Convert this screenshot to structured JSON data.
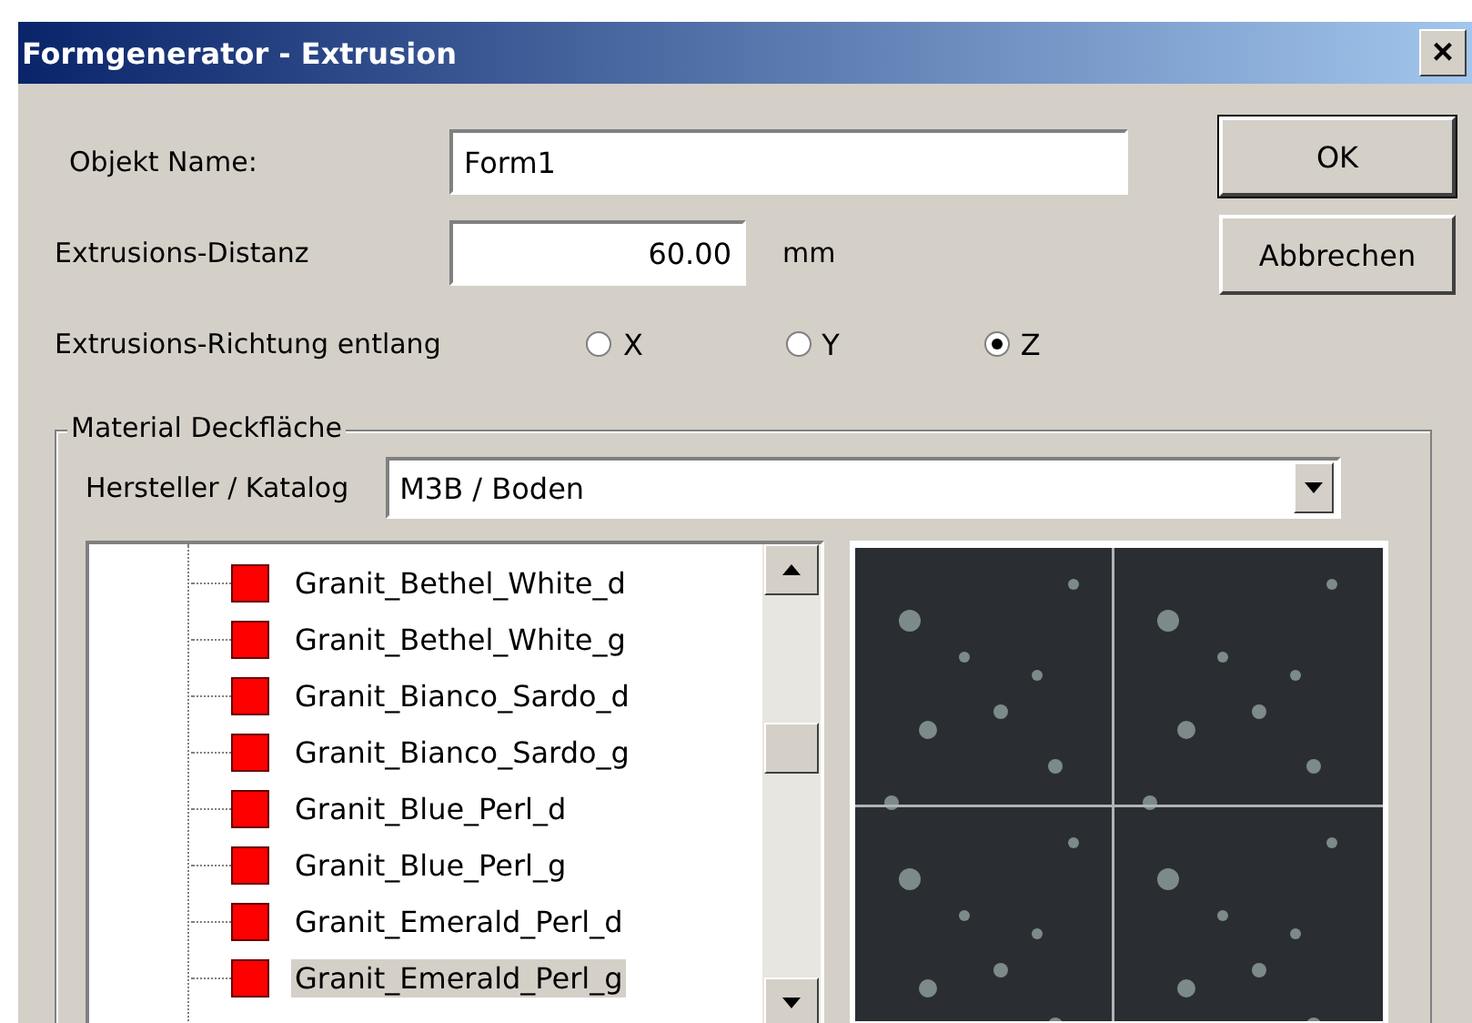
{
  "window": {
    "title": "Formgenerator - Extrusion",
    "close": "×"
  },
  "object_name": {
    "label": "Objekt Name:",
    "value": "Form1"
  },
  "distance": {
    "label": "Extrusions-Distanz",
    "value": "60.00",
    "unit": "mm"
  },
  "direction": {
    "label": "Extrusions-Richtung entlang",
    "options": [
      {
        "label": "X",
        "selected": false
      },
      {
        "label": "Y",
        "selected": false
      },
      {
        "label": "Z",
        "selected": true
      }
    ]
  },
  "buttons": [
    "OK",
    "Abbrechen"
  ],
  "material": {
    "title": "Material Deckfläche",
    "catalog_label": "Hersteller / Katalog",
    "catalog_value": "M3B / Boden",
    "items": [
      {
        "label": "Granit_Bethel_White_d",
        "color": "#ff0000",
        "selected": false
      },
      {
        "label": "Granit_Bethel_White_g",
        "color": "#ff0000",
        "selected": false
      },
      {
        "label": "Granit_Bianco_Sardo_d",
        "color": "#ff0000",
        "selected": false
      },
      {
        "label": "Granit_Bianco_Sardo_g",
        "color": "#ff0000",
        "selected": false
      },
      {
        "label": "Granit_Blue_Perl_d",
        "color": "#ff0000",
        "selected": false
      },
      {
        "label": "Granit_Blue_Perl_g",
        "color": "#ff0000",
        "selected": false
      },
      {
        "label": "Granit_Emerald_Perl_d",
        "color": "#ff0000",
        "selected": false
      },
      {
        "label": "Granit_Emerald_Perl_g",
        "color": "#ff0000",
        "selected": true
      }
    ]
  }
}
